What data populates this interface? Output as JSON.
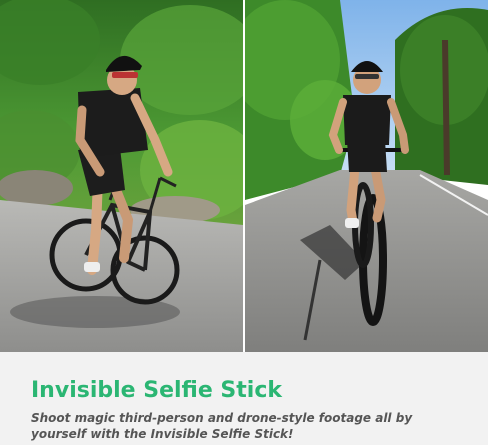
{
  "headline": {
    "text": "Invisible Selfie Stick",
    "color": "#2bb673"
  },
  "subtext": {
    "text": "Shoot magic third-person and drone-style footage all by yourself with the Invisible Selfie Stick!",
    "color": "#555555"
  },
  "colors": {
    "caption_background": "#f2f2f2",
    "foliage": "#3e8a2c",
    "road": "#9a9a98",
    "sky": "#9fc8ef"
  }
}
